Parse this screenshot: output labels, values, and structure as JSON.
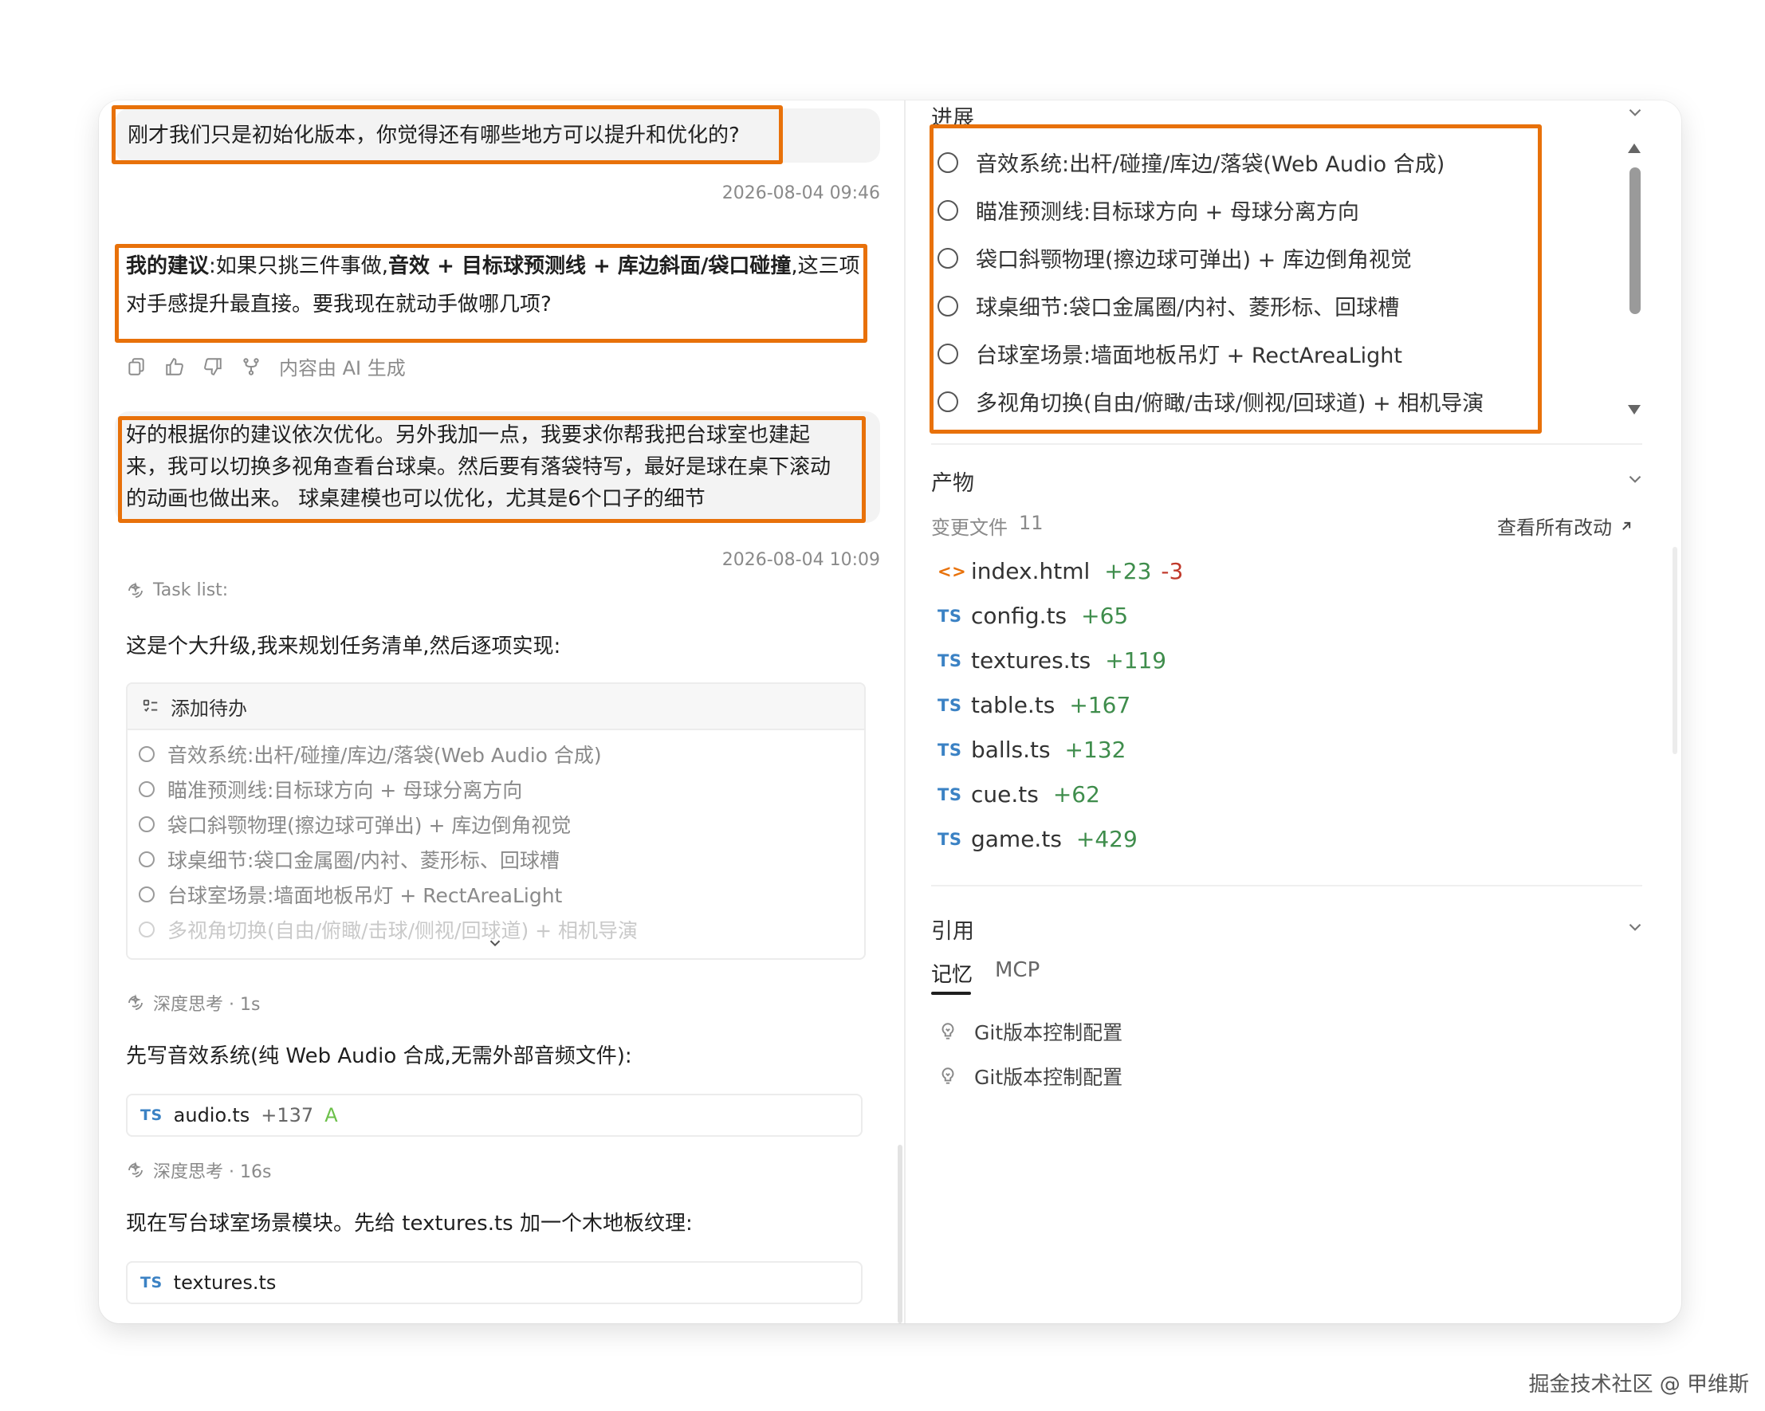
{
  "chat": {
    "message1": {
      "text": "刚才我们只是初始化版本，你觉得还有哪些地方可以提升和优化的?",
      "time": "2026-08-04 09:46"
    },
    "reply1": {
      "label": "我的建议",
      "sep1": ":如果只挑三件事做,",
      "kw1": "音效",
      "plus1": " + ",
      "kw2": "目标球预测线",
      "plus2": " + ",
      "kw3": "库边斜面/袋口碰撞",
      "tail1": ",这三项",
      "line2": "对手感提升最直接。要我现在就动手做哪几项?"
    },
    "actions": {
      "ai_note": "内容由 AI 生成"
    },
    "message2": {
      "line1": "好的根据你的建议依次优化。另外我加一点，我要求你帮我把台球室也建起",
      "line2": "来，我可以切换多视角查看台球桌。然后要有落袋特写，最好是球在桌下滚动",
      "line3": "的动画也做出来。 球桌建模也可以优化，尤其是6个口子的细节",
      "time": "2026-08-04 10:09"
    },
    "task_list_label": "Task list:",
    "plan_text": "这是个大升级,我来规划任务清单,然后逐项实现:",
    "todo": {
      "title": "添加待办",
      "items": [
        "音效系统:出杆/碰撞/库边/落袋(Web Audio 合成)",
        "瞄准预测线:目标球方向 + 母球分离方向",
        "袋口斜颚物理(擦边球可弹出) + 库边倒角视觉",
        "球桌细节:袋口金属圈/内衬、菱形标、回球槽",
        "台球室场景:墙面地板吊灯 + RectAreaLight",
        "多视角切换(自由/俯瞰/击球/侧视/回球道) + 相机导演"
      ]
    },
    "think1": "深度思考 · 1s",
    "audio_text": "先写音效系统(纯 Web Audio 合成,无需外部音频文件):",
    "audio_file": {
      "badge": "TS",
      "name": "audio.ts",
      "add": "+137",
      "status": "A"
    },
    "think2": "深度思考 · 16s",
    "texture_text": "现在写台球室场景模块。先给 textures.ts 加一个木地板纹理:",
    "texture_file": {
      "badge": "TS",
      "name": "textures.ts"
    }
  },
  "panel": {
    "progress": {
      "title": "进展",
      "items": [
        "音效系统:出杆/碰撞/库边/落袋(Web Audio 合成)",
        "瞄准预测线:目标球方向 + 母球分离方向",
        "袋口斜颚物理(擦边球可弹出) + 库边倒角视觉",
        "球桌细节:袋口金属圈/内衬、菱形标、回球槽",
        "台球室场景:墙面地板吊灯 + RectAreaLight",
        "多视角切换(自由/俯瞰/击球/侧视/回球道) + 相机导演"
      ]
    },
    "artifacts": {
      "title": "产物",
      "changed_label": "变更文件",
      "changed_count": "11",
      "view_all": "查看所有改动",
      "files": [
        {
          "badge": "<>",
          "name": "index.html",
          "add": "+23",
          "del": "-3"
        },
        {
          "badge": "TS",
          "name": "config.ts",
          "add": "+65",
          "del": ""
        },
        {
          "badge": "TS",
          "name": "textures.ts",
          "add": "+119",
          "del": ""
        },
        {
          "badge": "TS",
          "name": "table.ts",
          "add": "+167",
          "del": ""
        },
        {
          "badge": "TS",
          "name": "balls.ts",
          "add": "+132",
          "del": ""
        },
        {
          "badge": "TS",
          "name": "cue.ts",
          "add": "+62",
          "del": ""
        },
        {
          "badge": "TS",
          "name": "game.ts",
          "add": "+429",
          "del": ""
        }
      ]
    },
    "references": {
      "title": "引用",
      "tabs": [
        "记忆",
        "MCP"
      ],
      "items": [
        "Git版本控制配置",
        "Git版本控制配置"
      ]
    }
  },
  "watermark": "掘金技术社区 @ 甲维斯",
  "colors": {
    "highlight": "#e8710a",
    "ts_badge": "#3b82c4",
    "add": "#3f8d4c",
    "del": "#c0392b"
  }
}
